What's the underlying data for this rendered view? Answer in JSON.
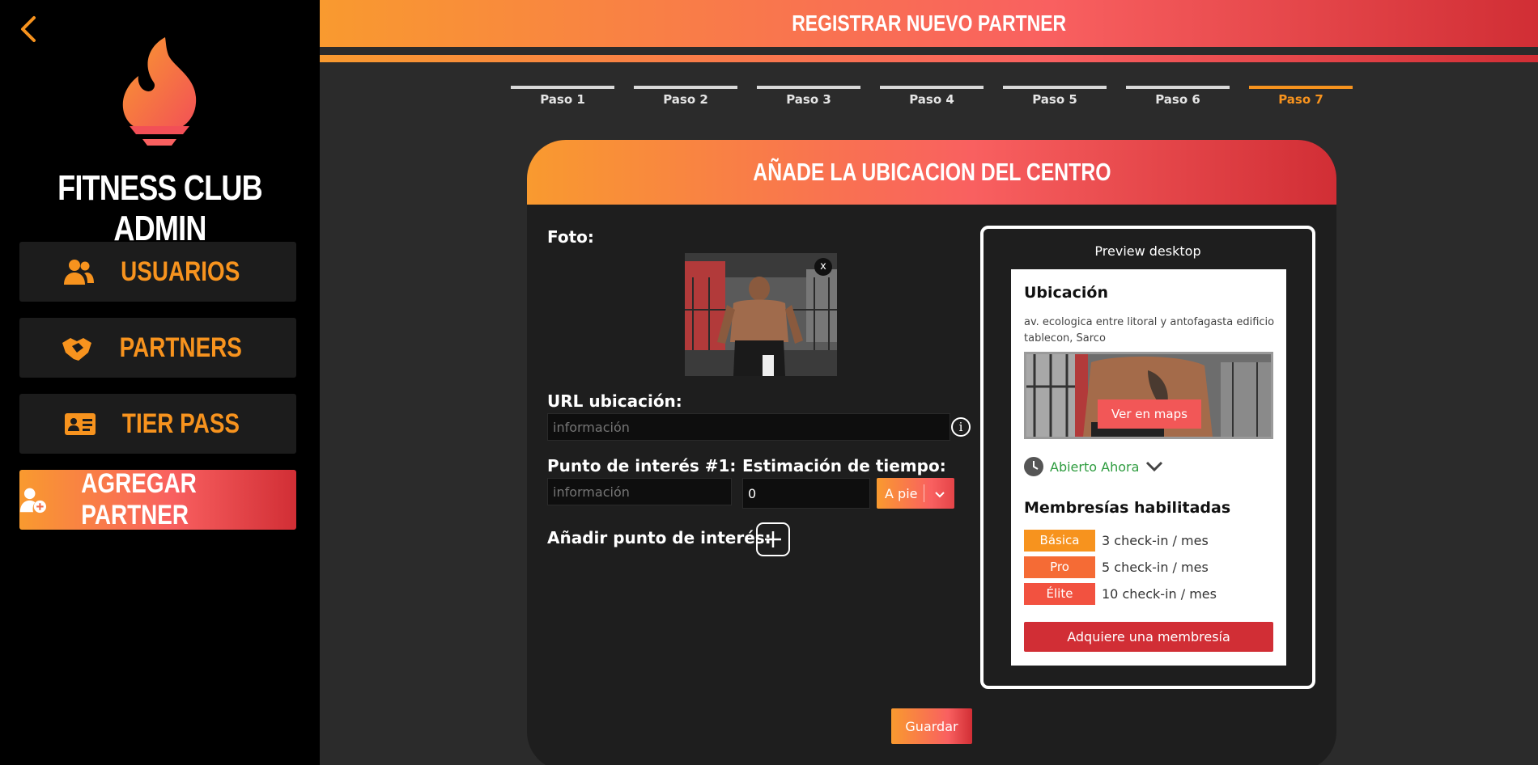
{
  "sidebar": {
    "brand": "FITNESS CLUB ADMIN",
    "items": [
      {
        "label": "USUARIOS",
        "icon": "users-icon"
      },
      {
        "label": "PARTNERS",
        "icon": "handshake-icon"
      },
      {
        "label": "TIER PASS",
        "icon": "id-card-icon"
      },
      {
        "label": "AGREGAR PARTNER",
        "icon": "user-plus-icon"
      }
    ]
  },
  "header": {
    "title": "REGISTRAR NUEVO PARTNER"
  },
  "steps": [
    "Paso 1",
    "Paso 2",
    "Paso 3",
    "Paso 4",
    "Paso 5",
    "Paso 6",
    "Paso 7"
  ],
  "form": {
    "title": "AÑADE LA UBICACION DEL CENTRO",
    "photo_label": "Foto:",
    "photo_close": "x",
    "url_label": "URL ubicación:",
    "url_placeholder": "información",
    "poi_label": "Punto de interés #1:",
    "poi_placeholder": "información",
    "time_label": "Estimación de tiempo:",
    "time_value": "0",
    "mode_value": "A pie",
    "add_poi_label": "Añadir punto de interés:",
    "save_label": "Guardar"
  },
  "preview": {
    "title": "Preview desktop",
    "location_title": "Ubicación",
    "address": "av. ecologica entre litoral y antofagasta edificio tablecon, Sarco",
    "maps_button": "Ver en maps",
    "hours_status": "Abierto Ahora",
    "memberships_title": "Membresías habilitadas",
    "tiers": [
      {
        "name": "Básica",
        "desc": "3 check-in / mes",
        "color": "#f7931e"
      },
      {
        "name": "Pro",
        "desc": "5 check-in / mes",
        "color": "#f56b35"
      },
      {
        "name": "Élite",
        "desc": "10 check-in / mes",
        "color": "#f25240"
      }
    ],
    "buy_button": "Adquiere una membresía"
  },
  "colors": {
    "accent_orange": "#f7931e",
    "accent_red": "#d12e35",
    "open_green": "#2e9c3f"
  }
}
